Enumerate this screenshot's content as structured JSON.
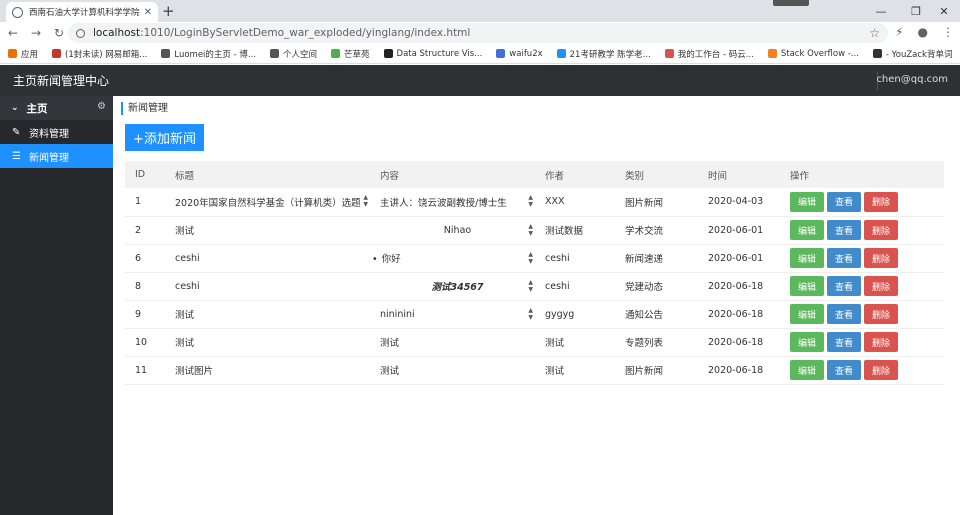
{
  "browser": {
    "tab_title": "西南石油大学计算机科学学院新",
    "url_host": "localhost",
    "url_path": ":1010/LoginByServletDemo_war_exploded/yinglang/index.html",
    "bookmarks": [
      {
        "label": "应用",
        "icon_color": "#e8710a"
      },
      {
        "label": "(1封未读) 网易邮箱...",
        "icon_color": "#c0392b"
      },
      {
        "label": "Luomei的主页 - 博...",
        "icon_color": "#555555"
      },
      {
        "label": "个人空间",
        "icon_color": "#555555"
      },
      {
        "label": "芒草苑",
        "icon_color": "#4caf50"
      },
      {
        "label": "Data Structure Vis...",
        "icon_color": "#222222"
      },
      {
        "label": "waifu2x",
        "icon_color": "#3f6fd8"
      },
      {
        "label": "21考研教学 陈学老...",
        "icon_color": "#1e90ff"
      },
      {
        "label": "我的工作台 - 码云...",
        "icon_color": "#d9534f"
      },
      {
        "label": "Stack Overflow -...",
        "icon_color": "#f48024"
      },
      {
        "label": "- YouZack背单词",
        "icon_color": "#333333"
      }
    ]
  },
  "app": {
    "brand": "主页新闻管理中心",
    "user": "chen@qq.com"
  },
  "sidebar": {
    "home": "主页",
    "items": [
      {
        "label": "资料管理",
        "icon": "pencil-icon"
      },
      {
        "label": "新闻管理",
        "icon": "list-icon",
        "active": true
      }
    ]
  },
  "main": {
    "breadcrumb": "新闻管理",
    "add_button": "+添加新闻",
    "columns": [
      "ID",
      "标题",
      "内容",
      "作者",
      "类别",
      "时间",
      "操作"
    ],
    "ops": {
      "edit": "编辑",
      "view": "查看",
      "del": "删除"
    },
    "rows": [
      {
        "id": "1",
        "title": "2020年国家自然科学基金（计算机类）选题",
        "content": "主讲人：饶云波副教授/博士生",
        "author": "XXX",
        "category": "图片新闻",
        "date": "2020-04-03",
        "title_spin": true,
        "content_spin": true,
        "style": ""
      },
      {
        "id": "2",
        "title": "测试",
        "content": "Nihao",
        "author": "测试数据",
        "category": "学术交流",
        "date": "2020-06-01",
        "title_spin": false,
        "content_spin": true,
        "style": "center"
      },
      {
        "id": "6",
        "title": "ceshi",
        "content": "你好",
        "author": "ceshi",
        "category": "新闻速递",
        "date": "2020-06-01",
        "title_spin": false,
        "content_spin": true,
        "style": "bullet"
      },
      {
        "id": "8",
        "title": "ceshi",
        "content": "测试34567",
        "author": "ceshi",
        "category": "党建动态",
        "date": "2020-06-18",
        "title_spin": false,
        "content_spin": true,
        "style": "bold"
      },
      {
        "id": "9",
        "title": "测试",
        "content": "nininini",
        "author": "gygyg",
        "category": "通知公告",
        "date": "2020-06-18",
        "title_spin": false,
        "content_spin": true,
        "style": ""
      },
      {
        "id": "10",
        "title": "测试",
        "content": "测试",
        "author": "测试",
        "category": "专题列表",
        "date": "2020-06-18",
        "title_spin": false,
        "content_spin": false,
        "style": ""
      },
      {
        "id": "11",
        "title": "测试图片",
        "content": "测试",
        "author": "测试",
        "category": "图片新闻",
        "date": "2020-06-18",
        "title_spin": false,
        "content_spin": false,
        "style": ""
      }
    ]
  }
}
